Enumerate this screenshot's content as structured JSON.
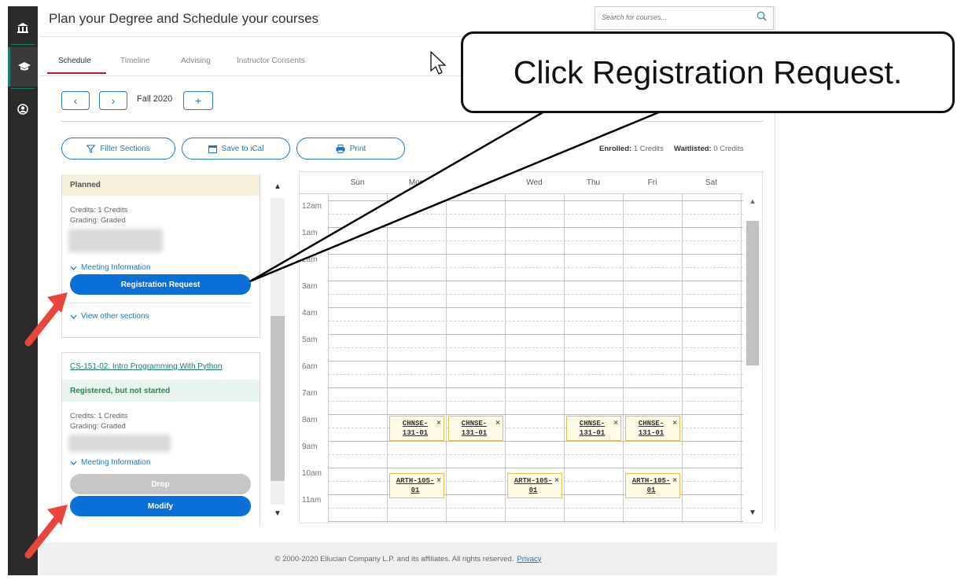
{
  "header": {
    "title": "Plan your Degree and Schedule your courses",
    "search_placeholder": "Search for courses..."
  },
  "tabs": [
    {
      "label": "Schedule",
      "active": true
    },
    {
      "label": "Timeline"
    },
    {
      "label": "Advising"
    },
    {
      "label": "Instructor Consents"
    }
  ],
  "term_nav": {
    "term": "Fall 2020",
    "prev": "‹",
    "next": "›",
    "add": "+"
  },
  "actions": {
    "filter": "Filter Sections",
    "ical": "Save to iCal",
    "print": "Print"
  },
  "credits": {
    "enrolled_label": "Enrolled:",
    "enrolled_value": "1 Credits",
    "waitlisted_label": "Waitlisted:",
    "waitlisted_value": "0 Credits"
  },
  "course_planned": {
    "status": "Planned",
    "credits": "Credits: 1 Credits",
    "grading": "Grading: Graded",
    "meeting_info": "Meeting Information",
    "register_button": "Registration Request",
    "other_sections": "View other sections"
  },
  "course_registered": {
    "title": "CS-151-02: Intro Programming With Python",
    "status": "Registered, but not started",
    "credits": "Credits: 1 Credits",
    "grading": "Grading: Graded",
    "meeting_info": "Meeting Information",
    "drop_button": "Drop",
    "modify_button": "Modify"
  },
  "calendar": {
    "days": [
      "Sun",
      "Mon",
      "Tue",
      "Wed",
      "Thu",
      "Fri",
      "Sat"
    ],
    "hours": [
      "12am",
      "1am",
      "2am",
      "3am",
      "4am",
      "5am",
      "6am",
      "7am",
      "8am",
      "9am",
      "10am",
      "11am"
    ],
    "events": [
      {
        "label_1": "CHNSE-",
        "label_2": "131-01"
      },
      {
        "label_1": "CHNSE-",
        "label_2": "131-01"
      },
      {
        "label_1": "CHNSE-",
        "label_2": "131-01"
      },
      {
        "label_1": "CHNSE-",
        "label_2": "131-01"
      },
      {
        "label_1": "ARTH-105-",
        "label_2": "01"
      },
      {
        "label_1": "ARTH-105-",
        "label_2": "01"
      },
      {
        "label_1": "ARTH-105-",
        "label_2": "01"
      }
    ]
  },
  "footer": {
    "text": "© 2000-2020 Ellucian Company L.P. and its affiliates. All rights reserved.",
    "privacy": "Privacy"
  },
  "callout": {
    "text": "Click Registration Request."
  },
  "colors": {
    "accent": "#0a6fd6",
    "tab_underline": "#b51e2a",
    "annotation_arrow": "#e8453c",
    "event_bg": "#fffbe6",
    "event_border": "#e0c14a"
  }
}
